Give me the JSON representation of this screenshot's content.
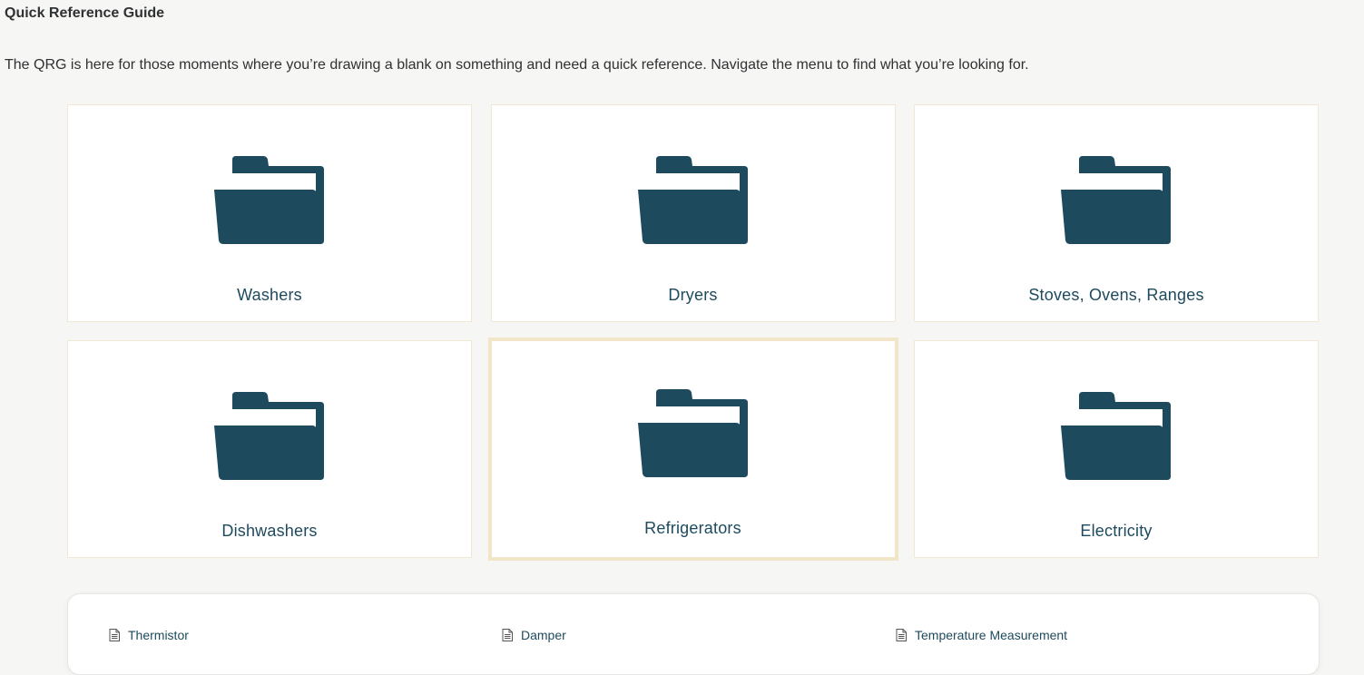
{
  "page": {
    "title": "Quick Reference Guide",
    "intro": "The QRG is here for those moments where you’re drawing a blank on something and need a quick reference. Navigate the menu to find what you’re looking for."
  },
  "categories": [
    {
      "label": "Washers",
      "icon": "folder-icon"
    },
    {
      "label": "Dryers",
      "icon": "folder-icon"
    },
    {
      "label": "Stoves, Ovens, Ranges",
      "icon": "folder-icon"
    },
    {
      "label": "Dishwashers",
      "icon": "folder-icon"
    },
    {
      "label": "Refrigerators",
      "icon": "folder-icon",
      "selected": true
    },
    {
      "label": "Electricity",
      "icon": "folder-icon"
    }
  ],
  "subitems": [
    {
      "label": "Thermistor",
      "icon": "document-icon"
    },
    {
      "label": "Damper",
      "icon": "document-icon"
    },
    {
      "label": "Temperature Measurement",
      "icon": "document-icon"
    }
  ],
  "colors": {
    "accent": "#1e4a5e",
    "background": "#f6f7f4",
    "card_border": "#f1e7d4",
    "selected_border": "#f2e6c9"
  }
}
